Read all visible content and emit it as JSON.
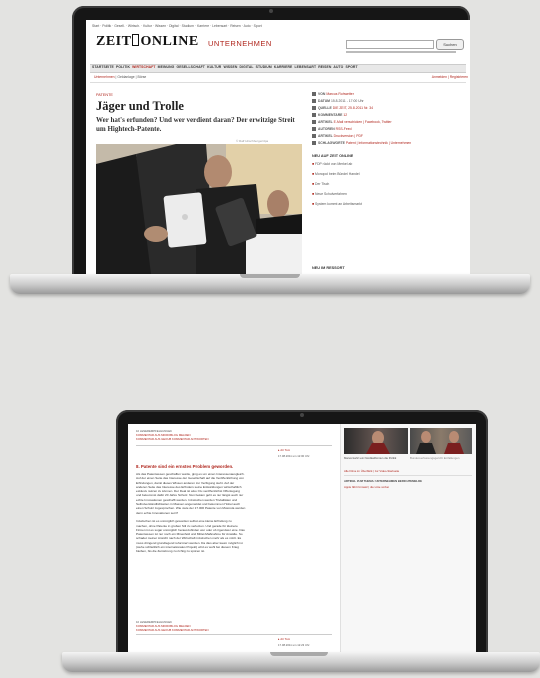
{
  "top_laptop": {
    "nav_links": [
      "Start",
      "Politik",
      "Gesell.",
      "Wirtsch.",
      "Kultur",
      "Wissen",
      "Digital",
      "Studium",
      "Karriere",
      "Lebensart",
      "Reisen",
      "Auto",
      "Sport"
    ],
    "brand_left": "ZEIT",
    "brand_right": "ONLINE",
    "section_title": "UNTERNEHMEN",
    "search_button": "Suchen",
    "main_nav": [
      "STARTSEITE",
      "POLITIK",
      "WIRTSCHAFT",
      "MEINUNG",
      "GESELLSCHAFT",
      "KULTUR",
      "WISSEN",
      "DIGITAL",
      "STUDIUM",
      "KARRIERE",
      "LEBENSART",
      "REISEN",
      "AUTO",
      "SPORT"
    ],
    "sub_nav": [
      "Unternehmen",
      "Geldanlage",
      "Börse"
    ],
    "sub_nav_right": "Anmelden | Registrieren",
    "kicker": "PATENTE",
    "headline": "Jäger und Trolle",
    "deck": "Wer hat's erfunden? Und wer verdient daran? Der erwitzige Streit um Hightech-Patente.",
    "photo_credit": "© Ralf Hirschberger/dpa",
    "meta": [
      {
        "label": "VON",
        "value": "Marcus Rohwetter"
      },
      {
        "label": "DATUM",
        "value": "15.8.2011 - 17:00 Uhr"
      },
      {
        "label": "QUELLE",
        "value": "DIE ZEIT, 25.8.2011 Nr. 34"
      },
      {
        "label": "KOMMENTARE",
        "value": "12"
      },
      {
        "label": "ARTIKEL",
        "value": "E-Mail verschicken | Facebook, Twitter"
      },
      {
        "label": "AUTOREN",
        "value": "RSS-Feed"
      },
      {
        "label": "ARTIKEL",
        "value": "Druckversion | PDF"
      },
      {
        "label": "SCHLAGWORTE",
        "value": "Patent | Informationstechnik | Unternehmen"
      }
    ],
    "news_title": "NEU AUF ZEIT ONLINE",
    "news": [
      "FDP rückt von Merkel ab",
      "Monopol beim Bündel Handel",
      "Der Tisch",
      "Neue Schulverfahren",
      "System kommt an Arbeitsmarkt"
    ],
    "bottom_title": "NEU IM RESSORT"
  },
  "bottom_laptop": {
    "comment_head": [
      "10 LESEREMPFEHLUNGEN",
      "KOMMENTAR AUS MIKROBLOG MELDEN",
      "KOMMENTAR AUS GEOUB KOMMENTAR ANTWORTEN"
    ],
    "comment_user": "dtr Tom",
    "comment_date": "17.08.2011 um 12:00 Uhr",
    "comment_title": "8. Patente sind ein ernstes Problem geworden.",
    "comment_body": [
      "Als das Patentwesen geschaffen wurde, ging es um einen Interessenausgleich.",
      "Auf der einen Seite das Interesse der Gesellschaft auf die Veröffentlichung von",
      "Erfindungen, damit dieses Wissen anderen zur Verfügung steht. Auf der",
      "anderen Seite das Interesse des Erfinders seine Entwicklungen wirtschaftlich",
      "exklusiv nutzen zu können. Der Deal ist also: Du veröffentlichst Offenlegung",
      "und bekommst dafür 20 Jahre Schutz. Nun bekam geht es nur längst auch nur",
      "echte Innovationen geschafft werden. Inzwischen werden Trivialitäten und",
      "Selbstverständlichkeiten in Massen angemeldet und bekommen Hobel auch",
      "einen Schutz zugesprochen. Wie viele der 17.000 Patente von Motorola werden",
      "denn echte Innovationen sein?",
      "",
      "Inzwischen ist es unmöglich geworden selbst eine kleine Erfindung zu",
      "machen, ohne Patente in großen Stil zu verletzen. Und gerade für kleinere",
      "Firmen ist es sogar unmöglich herauszufinden wer oder ob irgendwer eine. Das",
      "Patentwesen ist nur noch ein Minenfeld und Mittel-Maßnahme für Anwälte. So",
      "schadet meiner Ansicht nach der Wirtschaft inzwischen mehr als es nützt. Es",
      "muss dringend grundlegend reformiert werden. Da dies aber kaum möglich ist",
      "(siehe schließlich ein internationales Projekt) wird es wohl bei diesem Krieg",
      "bleiben, bis die Zerstörung zu richtig zu spüren ist."
    ],
    "comment_foot": [
      "10 LESEREMPFEHLUNGEN",
      "KOMMENTAR AUS MIKROBLOG MELDEN",
      "KOMMENTAR AUS GEOUB KOMMENTAR ANTWORTEN"
    ],
    "reply_user": "dtr Tom",
    "reply_date": "17.08.2011 um 12:23 Uhr",
    "video_caption_left": "Marvel kehrt ein Nordkalifornien die Politik",
    "video_caption_right": "Bundesverfassungsgericht Entfaltungen",
    "video_more": "Alle Filme im Überblick | zur Video-Startseite",
    "bottom_head": "ARTIKEL ZUM THEMA: UNTERNEHMEN BERICHTEMELDE",
    "bottom_link": "Apple fährt Umsatz | die Linie vorbei"
  }
}
